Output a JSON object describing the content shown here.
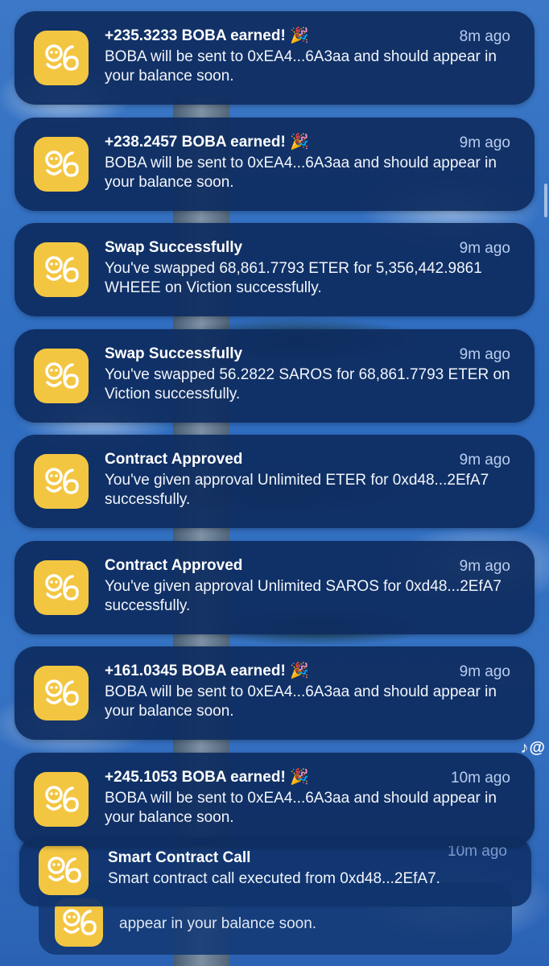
{
  "app_icon": "boba-app-icon",
  "watermark": "♪@",
  "notifications": [
    {
      "title": "+235.3233 BOBA earned! 🎉",
      "time": "8m ago",
      "body": "BOBA will be sent to 0xEA4...6A3aa and should appear in your balance soon."
    },
    {
      "title": "+238.2457 BOBA earned! 🎉",
      "time": "9m ago",
      "body": "BOBA will be sent to 0xEA4...6A3aa and should appear in your balance soon."
    },
    {
      "title": "Swap Successfully",
      "time": "9m ago",
      "body": "You've swapped 68,861.7793 ETER for 5,356,442.9861 WHEEE on Viction successfully."
    },
    {
      "title": "Swap Successfully",
      "time": "9m ago",
      "body": "You've swapped 56.2822 SAROS for 68,861.7793 ETER on Viction successfully."
    },
    {
      "title": "Contract Approved",
      "time": "9m ago",
      "body": "You've given approval Unlimited ETER for 0xd48...2EfA7 successfully."
    },
    {
      "title": "Contract Approved",
      "time": "9m ago",
      "body": "You've given approval Unlimited SAROS for 0xd48...2EfA7 successfully."
    },
    {
      "title": "+161.0345 BOBA earned! 🎉",
      "time": "9m ago",
      "body": "BOBA will be sent to 0xEA4...6A3aa and should appear in your balance soon."
    },
    {
      "title": "+245.1053 BOBA earned! 🎉",
      "time": "10m ago",
      "body": "BOBA will be sent to 0xEA4...6A3aa and should appear in your balance soon."
    }
  ],
  "stacked": {
    "front": {
      "title": "Smart Contract Call",
      "time": "10m ago",
      "body": "Smart contract call executed from 0xd48...2EfA7."
    },
    "back": {
      "body": "appear in your balance soon."
    }
  }
}
